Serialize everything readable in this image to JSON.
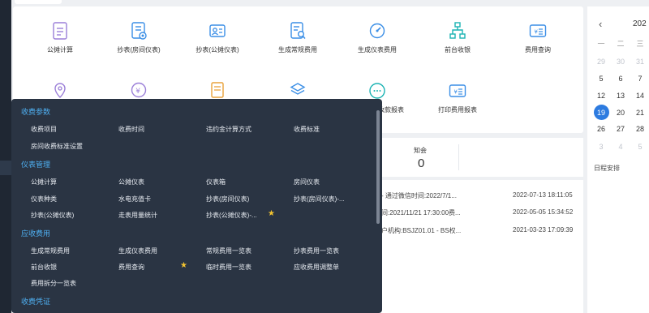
{
  "shortcuts": [
    {
      "label": "公摊计算",
      "icon": "document-icon"
    },
    {
      "label": "抄表(房间仪表)",
      "icon": "meter-document-icon"
    },
    {
      "label": "抄表(公摊仪表)",
      "icon": "id-card-icon"
    },
    {
      "label": "生成常规费用",
      "icon": "document-search-icon"
    },
    {
      "label": "生成仪表费用",
      "icon": "gauge-icon"
    },
    {
      "label": "前台收银",
      "icon": "org-chart-icon"
    },
    {
      "label": "费用查询",
      "icon": "yuan-card-icon"
    },
    {
      "label": "",
      "icon": "location-pin-icon"
    },
    {
      "label": "",
      "icon": "yuan-circle-icon"
    },
    {
      "label": "",
      "icon": "list-document-icon"
    },
    {
      "label": "",
      "icon": "layers-icon"
    },
    {
      "label": "生成收款报表",
      "icon": "chat-bubble-icon"
    },
    {
      "label": "打印费用报表",
      "icon": "yuan-card-icon"
    }
  ],
  "stat": {
    "label": "知会",
    "value": "0"
  },
  "messages": [
    {
      "text": "- 通过微信时间:2022/7/1...",
      "date": "2022-07-13 18:11:05"
    },
    {
      "text": "间:2021/11/21 17:30:00费...",
      "date": "2022-05-05 15:34:52"
    },
    {
      "text": "户机构:BSJZ01.01 - BS权...",
      "date": "2021-03-23 17:09:39"
    }
  ],
  "calendar": {
    "year_label": "202",
    "weekdays": [
      "一",
      "二",
      "三"
    ],
    "rows": [
      [
        "29",
        "30",
        "31"
      ],
      [
        "5",
        "6",
        "7"
      ],
      [
        "12",
        "13",
        "14"
      ],
      [
        "19",
        "20",
        "21"
      ],
      [
        "26",
        "27",
        "28"
      ],
      [
        "3",
        "4",
        "5"
      ]
    ],
    "selected": "19",
    "schedule_label": "日程安排"
  },
  "menu": {
    "sections": [
      {
        "title": "收费参数",
        "items": [
          "收费项目",
          "收费时间",
          "违约金计算方式",
          "收费标准",
          "房间收费标准设置"
        ]
      },
      {
        "title": "仪表管理",
        "items": [
          "公摊计算",
          "公摊仪表",
          "仪表箱",
          "房间仪表",
          "仪表种类",
          "水电充值卡",
          "抄表(房间仪表)",
          "抄表(房间仪表)-...",
          "抄表(公摊仪表)",
          "走表用量统计",
          "抄表(公摊仪表)-..."
        ]
      },
      {
        "title": "应收费用",
        "items": [
          "生成常规费用",
          "生成仪表费用",
          "常规费用一览表",
          "抄表费用一览表",
          "前台收银",
          "费用查询",
          "临时费用一览表",
          "应收费用调整单",
          "费用拆分一览表"
        ]
      },
      {
        "title": "收费凭证",
        "items": []
      }
    ]
  },
  "colors": {
    "menu_bg": "#2a3443",
    "section_title": "#4fb0f2",
    "icon_blue": "#3a8ee6",
    "icon_purple": "#9b7fd8",
    "icon_orange": "#e9a23b",
    "icon_teal": "#1bb3b3",
    "star": "#f4c430",
    "selected_day": "#2d7be0"
  }
}
